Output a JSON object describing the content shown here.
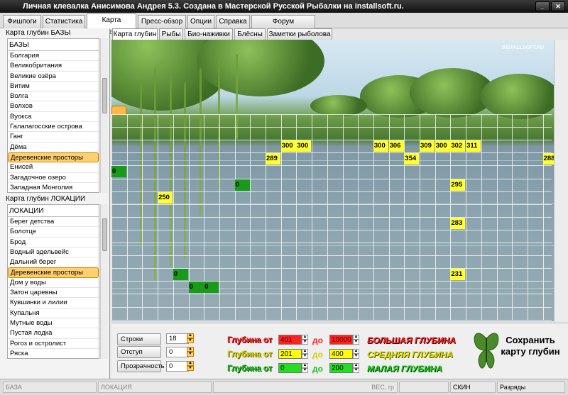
{
  "window": {
    "title": "Личная клевалка Анисимова Андрея 5.3. Создана в Мастерской Русской Рыбалки на installsoft.ru."
  },
  "menu_tabs": [
    "Фишпоги",
    "Статистика",
    "Карта локаций",
    "Пресс-обзор",
    "Опции",
    "Справка",
    "Форум InstallSoft.ru"
  ],
  "active_menu_tab": "Карта локаций",
  "bases_panel": {
    "header": "Карта глубин БАЗЫ",
    "list_title": "БАЗЫ",
    "items": [
      "Болгария",
      "Великобритания",
      "Великие озёра",
      "Витим",
      "Волга",
      "Волхов",
      "Вуокса",
      "Галапагосские острова",
      "Ганг",
      "Дёма",
      "Деревенские просторы",
      "Енисей",
      "Загадочное озеро",
      "Западная Монголия"
    ],
    "selected": "Деревенские просторы"
  },
  "locations_panel": {
    "header": "Карта глубин ЛОКАЦИИ",
    "list_title": "ЛОКАЦИИ",
    "items": [
      "Берег детства",
      "Болотце",
      "Брод",
      "Водный эдельвейс",
      "Дальний берег",
      "Деревенские просторы",
      "Дом у воды",
      "Затон царевны",
      "Кувшинки и лилии",
      "Купальня",
      "Мутные воды",
      "Пустая лодка",
      "Рогоз и остролист",
      "Ряска"
    ],
    "selected": "Деревенские просторы"
  },
  "sub_tabs": [
    "Карта глубин",
    "Рыбы",
    "Био-наживки",
    "Блёсны",
    "Заметки рыболова"
  ],
  "active_sub_tab": "Карта глубин",
  "watermark": "INSTALLSOFT.RU",
  "depth_cells": [
    {
      "value": "300",
      "row": 2,
      "col": 11,
      "type": "y"
    },
    {
      "value": "300",
      "row": 2,
      "col": 12,
      "type": "y"
    },
    {
      "value": "300",
      "row": 2,
      "col": 17,
      "type": "y"
    },
    {
      "value": "306",
      "row": 2,
      "col": 18,
      "type": "y"
    },
    {
      "value": "309",
      "row": 2,
      "col": 20,
      "type": "y"
    },
    {
      "value": "300",
      "row": 2,
      "col": 21,
      "type": "y"
    },
    {
      "value": "302",
      "row": 2,
      "col": 22,
      "type": "y"
    },
    {
      "value": "311",
      "row": 2,
      "col": 23,
      "type": "y"
    },
    {
      "value": "289",
      "row": 3,
      "col": 10,
      "type": "y"
    },
    {
      "value": "354",
      "row": 3,
      "col": 19,
      "type": "y"
    },
    {
      "value": "288",
      "row": 3,
      "col": 28,
      "type": "y"
    },
    {
      "value": "0",
      "row": 4,
      "col": 0,
      "type": "g"
    },
    {
      "value": "295",
      "row": 5,
      "col": 22,
      "type": "y"
    },
    {
      "value": "0",
      "row": 5,
      "col": 8,
      "type": "g"
    },
    {
      "value": "250",
      "row": 6,
      "col": 3,
      "type": "y"
    },
    {
      "value": "283",
      "row": 8,
      "col": 22,
      "type": "y"
    },
    {
      "value": "231",
      "row": 12,
      "col": 22,
      "type": "y"
    },
    {
      "value": "0",
      "row": 12,
      "col": 4,
      "type": "g"
    },
    {
      "value": "0",
      "row": 13,
      "col": 5,
      "type": "g"
    },
    {
      "value": "0",
      "row": 13,
      "col": 6,
      "type": "g"
    }
  ],
  "controls": {
    "rows_label": "Строки",
    "rows_value": "18",
    "indent_label": "Отступ слева",
    "indent_value": "0",
    "transparency_label": "Прозрачность",
    "transparency_value": "0",
    "depth_from_label": "Глубина от",
    "to_label": "до",
    "big": {
      "from": "401",
      "to": "10000",
      "label": "БОЛЬШАЯ ГЛУБИНА",
      "color": "#ff2020"
    },
    "mid": {
      "from": "201",
      "to": "400",
      "label": "СРЕДНЯЯ ГЛУБИНА",
      "color": "#ffff00"
    },
    "small": {
      "from": "0",
      "to": "200",
      "label": "МАЛАЯ ГЛУБИНА",
      "color": "#20e020"
    },
    "save_label": "Сохранить карту глубин"
  },
  "statusbar": {
    "base": "БАЗА",
    "location": "ЛОКАЦИЯ",
    "weight": "ВЕС, гр",
    "skin": "СКИН",
    "ranks": "Разряды"
  }
}
